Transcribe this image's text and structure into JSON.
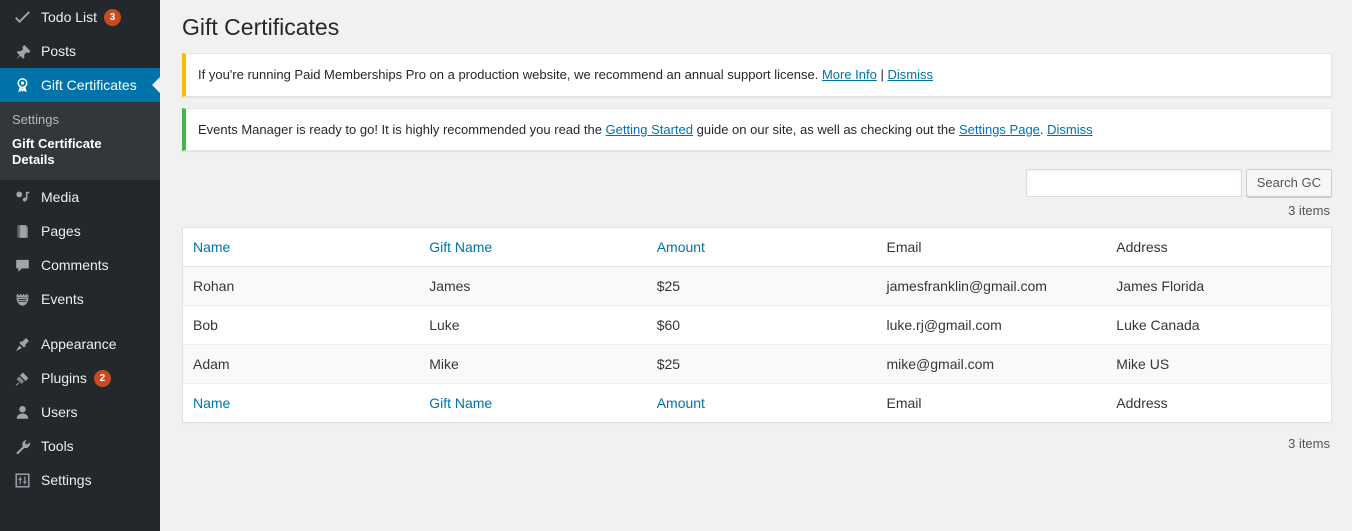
{
  "sidebar": {
    "items": [
      {
        "label": "Todo List",
        "icon": "check-icon",
        "badge": "3",
        "current": false,
        "separator_after": false
      },
      {
        "label": "Posts",
        "icon": "pin-icon",
        "badge": null,
        "current": false,
        "separator_after": false
      },
      {
        "label": "Gift Certificates",
        "icon": "award-icon",
        "badge": null,
        "current": true,
        "separator_after": false
      },
      {
        "label": "Media",
        "icon": "media-icon",
        "badge": null,
        "current": false,
        "separator_after": false
      },
      {
        "label": "Pages",
        "icon": "pages-icon",
        "badge": null,
        "current": false,
        "separator_after": false
      },
      {
        "label": "Comments",
        "icon": "comment-icon",
        "badge": null,
        "current": false,
        "separator_after": false
      },
      {
        "label": "Events",
        "icon": "calendar-icon",
        "badge": null,
        "current": false,
        "separator_after": true
      },
      {
        "label": "Appearance",
        "icon": "brush-icon",
        "badge": null,
        "current": false,
        "separator_after": false
      },
      {
        "label": "Plugins",
        "icon": "plug-icon",
        "badge": "2",
        "current": false,
        "separator_after": false
      },
      {
        "label": "Users",
        "icon": "user-icon",
        "badge": null,
        "current": false,
        "separator_after": false
      },
      {
        "label": "Tools",
        "icon": "wrench-icon",
        "badge": null,
        "current": false,
        "separator_after": false
      },
      {
        "label": "Settings",
        "icon": "sliders-icon",
        "badge": null,
        "current": false,
        "separator_after": false
      }
    ],
    "submenu": {
      "heading": "Settings",
      "items": [
        {
          "label": "Gift Certificate Details",
          "current": true
        }
      ]
    },
    "colors": {
      "background": "#23282d",
      "submenu_background": "#32373c",
      "current_highlight": "#0073aa",
      "badge": "#ca4a1f"
    }
  },
  "page": {
    "title": "Gift Certificates"
  },
  "notices": [
    {
      "type": "warning",
      "accent": "#ffb900",
      "text_before": "If you're running Paid Memberships Pro on a production website, we recommend an annual support license. ",
      "links": [
        "More Info",
        "Dismiss"
      ],
      "separator": " | ",
      "text_after": ""
    },
    {
      "type": "success",
      "accent": "#46b450",
      "text_before": "Events Manager is ready to go! It is highly recommended you read the ",
      "link1": "Getting Started",
      "text_middle": " guide on our site, as well as checking out the ",
      "link2": "Settings Page",
      "text_after": ". ",
      "link3": "Dismiss"
    }
  ],
  "search": {
    "value": "",
    "placeholder": "",
    "button_label": "Search GC"
  },
  "list": {
    "items_count_top": "3 items",
    "items_count_bottom": "3 items",
    "columns": [
      {
        "label": "Name",
        "sortable": true
      },
      {
        "label": "Gift Name",
        "sortable": true
      },
      {
        "label": "Amount",
        "sortable": true
      },
      {
        "label": "Email",
        "sortable": false
      },
      {
        "label": "Address",
        "sortable": false
      }
    ],
    "rows": [
      {
        "name": "Rohan",
        "gift_name": "James",
        "amount": "$25",
        "email": "jamesfranklin@gmail.com",
        "address": "James Florida"
      },
      {
        "name": "Bob",
        "gift_name": "Luke",
        "amount": "$60",
        "email": "luke.rj@gmail.com",
        "address": "Luke Canada"
      },
      {
        "name": "Adam",
        "gift_name": "Mike",
        "amount": "$25",
        "email": "mike@gmail.com",
        "address": "Mike US"
      }
    ]
  }
}
